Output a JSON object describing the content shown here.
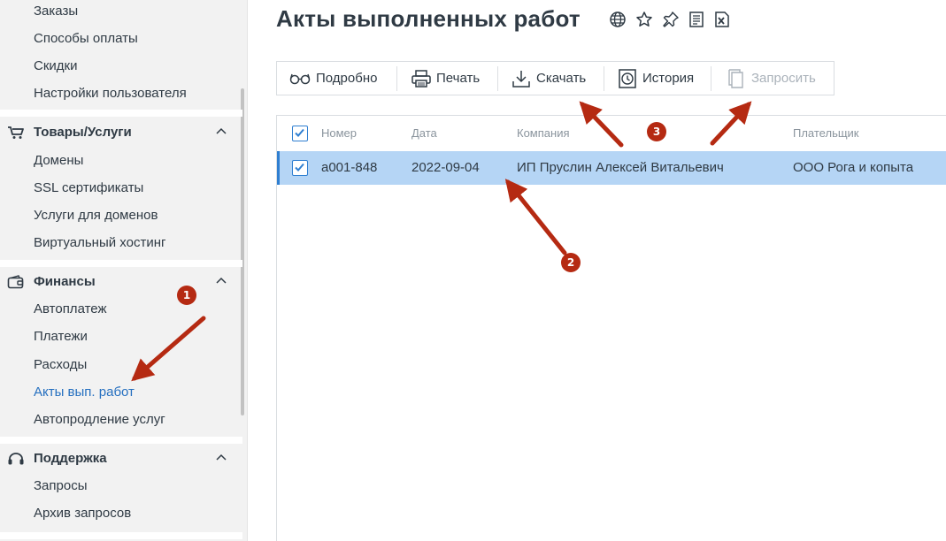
{
  "sidebar": {
    "top_items": [
      "Заказы",
      "Способы оплаты",
      "Скидки",
      "Настройки пользователя"
    ],
    "groups": [
      {
        "title": "Товары/Услуги",
        "icon": "cart-icon",
        "items": [
          "Домены",
          "SSL сертификаты",
          "Услуги для доменов",
          "Виртуальный хостинг"
        ]
      },
      {
        "title": "Финансы",
        "icon": "wallet-icon",
        "items": [
          "Автоплатеж",
          "Платежи",
          "Расходы",
          "Акты вып. работ",
          "Автопродление услуг"
        ],
        "active_item": "Акты вып. работ"
      },
      {
        "title": "Поддержка",
        "icon": "headset-icon",
        "items": [
          "Запросы",
          "Архив запросов"
        ]
      }
    ]
  },
  "page": {
    "title": "Акты выполненных работ",
    "title_icons": [
      "globe-icon",
      "star-icon",
      "pin-icon",
      "document-list-icon",
      "excel-icon"
    ]
  },
  "toolbar": {
    "details": "Подробно",
    "print": "Печать",
    "download": "Скачать",
    "history": "История",
    "request": "Запросить"
  },
  "table": {
    "headers": {
      "number": "Номер",
      "date": "Дата",
      "company": "Компания",
      "payer": "Плательщик"
    },
    "rows": [
      {
        "number": "а001-848",
        "date": "2022-09-04",
        "company": "ИП Пруслин Алексей Витальевич",
        "payer": "ООО Рога и копыта",
        "selected": true
      }
    ]
  },
  "annotations": {
    "badge1": "1",
    "badge2": "2",
    "badge3": "3"
  },
  "colors": {
    "accent": "#2f7fd1",
    "active_link": "#2670c0",
    "row_selected": "#b5d5f5",
    "annotation": "#b52a12"
  }
}
